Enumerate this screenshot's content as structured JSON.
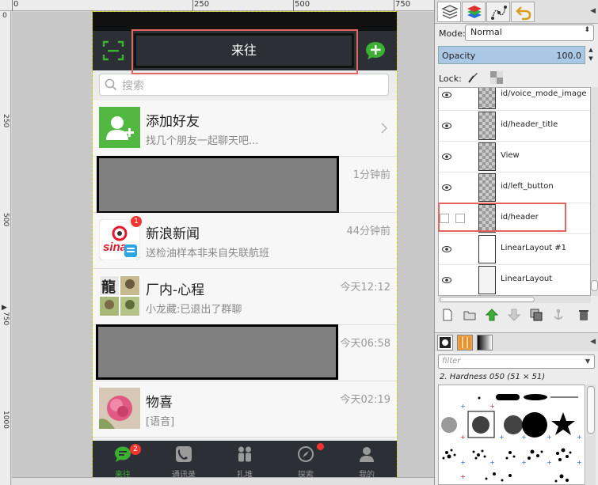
{
  "ruler": {
    "top_labels": [
      "0",
      "250",
      "500",
      "750"
    ],
    "left_labels": [
      "0",
      "250",
      "500",
      "750",
      "1000"
    ]
  },
  "phone": {
    "header": {
      "title": "来往"
    },
    "search": {
      "placeholder": "搜索"
    },
    "rows": [
      {
        "name": "添加好友",
        "sub": "找几个朋友一起聊天吧...",
        "time": ""
      },
      {
        "name": "",
        "sub": "",
        "time": "1分钟前"
      },
      {
        "name": "新浪新闻",
        "sub": "送检油样本非来自失联航班",
        "time": "44分钟前",
        "badge": "1"
      },
      {
        "name": "厂内-心程",
        "sub": "小龙藏:已退出了群聊",
        "time": "今天12:12"
      },
      {
        "name": "",
        "sub": "",
        "time": "今天06:58"
      },
      {
        "name": "物喜",
        "sub": "[语音]",
        "time": "今天02:19"
      }
    ],
    "tabs": [
      {
        "label": "来往",
        "badge": "2"
      },
      {
        "label": "通讯录"
      },
      {
        "label": "扎堆"
      },
      {
        "label": "探索"
      },
      {
        "label": "我的"
      }
    ],
    "colors": {
      "accent_green": "#3cb034",
      "header_bg": "#2c2f36",
      "badge_red": "#f43530",
      "highlight_box": "#e1675e"
    }
  },
  "layers_panel": {
    "mode_label": "Mode:",
    "mode_value": "Normal",
    "opacity_label": "Opacity",
    "opacity_value": "100.0",
    "lock_label": "Lock:",
    "layers": [
      {
        "name": "id/voice_mode_image",
        "visible": true
      },
      {
        "name": "id/header_title",
        "visible": true
      },
      {
        "name": "View",
        "visible": true
      },
      {
        "name": "id/left_button",
        "visible": true
      },
      {
        "name": "id/header",
        "visible": false
      },
      {
        "name": "LinearLayout #1",
        "visible": true
      },
      {
        "name": "LinearLayout",
        "visible": true
      }
    ]
  },
  "brushes_panel": {
    "filter_placeholder": "filter",
    "brush_name": "2. Hardness 050 (51 × 51)"
  }
}
